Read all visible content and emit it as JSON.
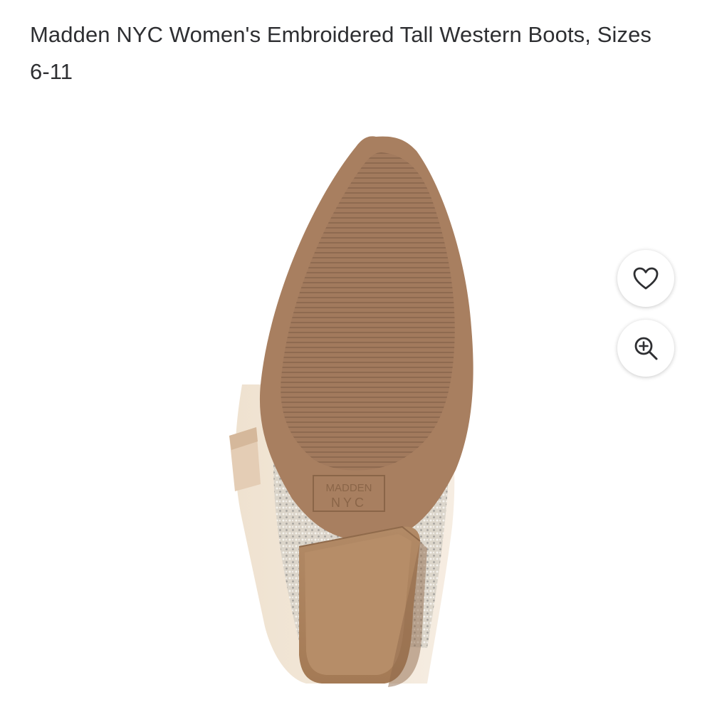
{
  "product": {
    "title": "Madden NYC Women's Embroidered Tall Western Boots, Sizes 6-11",
    "brand_stamp": "MADDEN NYC"
  },
  "actions": {
    "favorite_icon": "heart-outline-icon",
    "zoom_icon": "zoom-in-icon"
  },
  "colors": {
    "text": "#2e2f32",
    "sole": "#a57b5c",
    "heel": "#b08560",
    "button_bg": "#ffffff"
  }
}
